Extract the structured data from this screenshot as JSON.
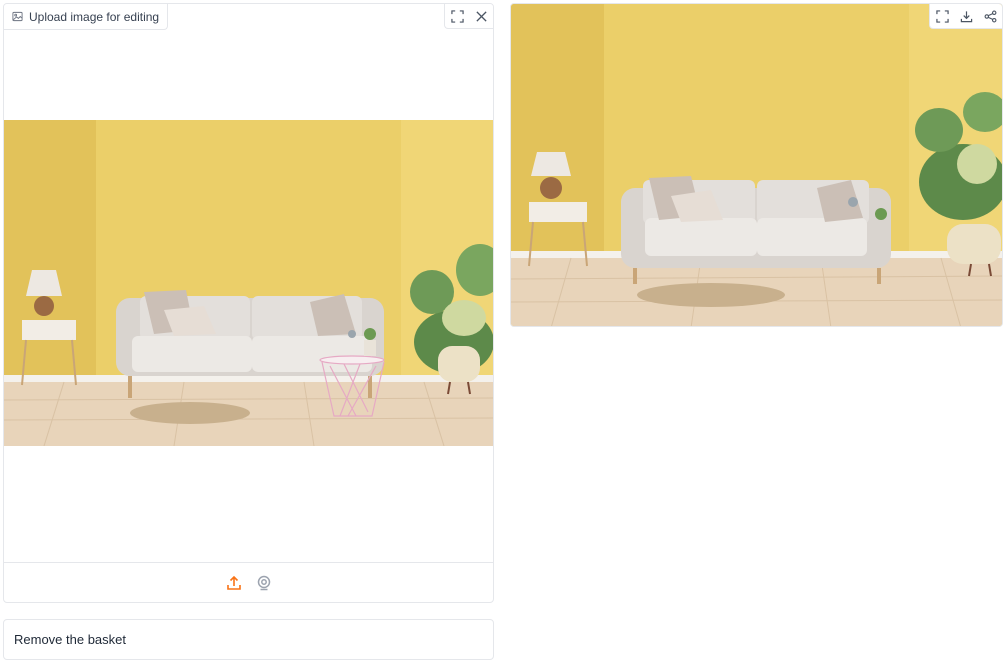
{
  "input_panel": {
    "label": "Upload image for editing",
    "icons": [
      "image-icon",
      "fullscreen-icon",
      "close-icon"
    ],
    "toolbar_icons": [
      "upload-icon",
      "webcam-icon"
    ],
    "upload_icon_color": "#f97316"
  },
  "output_panel": {
    "icons": [
      "fullscreen-icon",
      "download-icon",
      "share-icon"
    ]
  },
  "prompt": {
    "value": "Remove the basket"
  },
  "colors": {
    "wall": "#ecd06a",
    "floor": "#e7d2b7",
    "border": "#e5e7eb"
  }
}
